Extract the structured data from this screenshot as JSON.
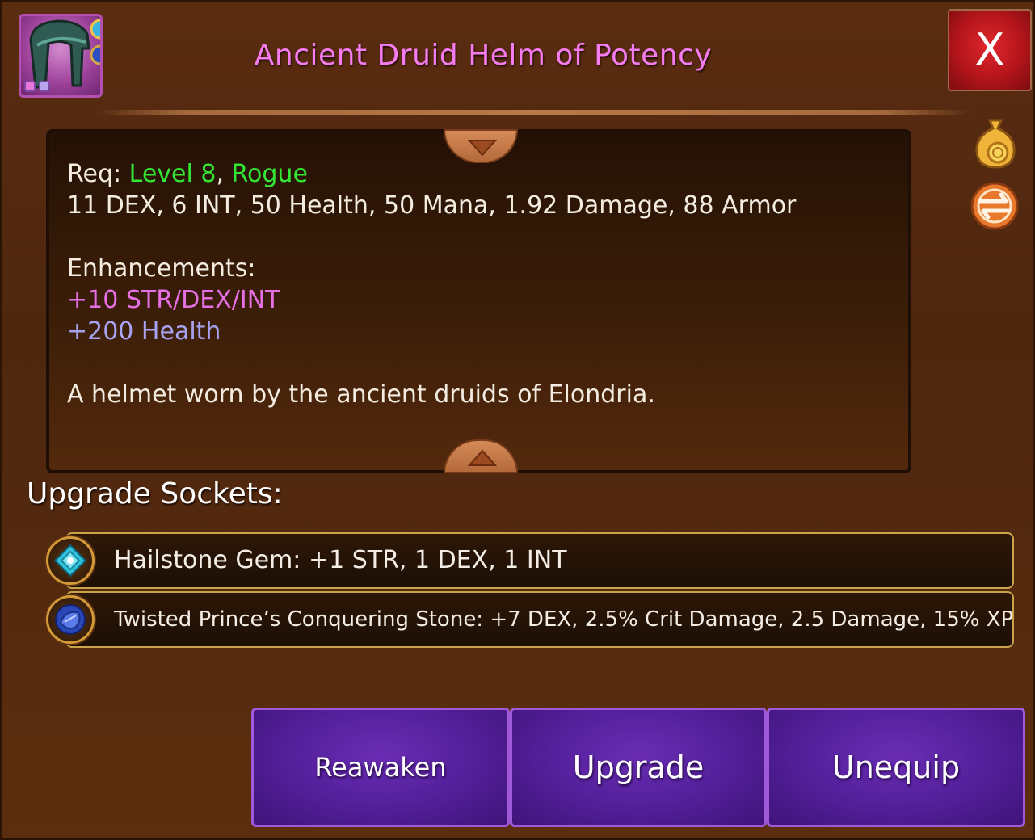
{
  "item": {
    "name": "Ancient Druid Helm of Potency",
    "icon": "druid-helm-icon"
  },
  "close_label": "X",
  "requirements": {
    "prefix": "Req: ",
    "level": "Level 8",
    "separator": ", ",
    "class": "Rogue"
  },
  "stats_line": "11 DEX, 6 INT, 50 Health, 50 Mana, 1.92 Damage, 88 Armor",
  "enhancements": {
    "heading": "Enhancements:",
    "lines": [
      "+10 STR/DEX/INT",
      "+200 Health"
    ]
  },
  "description": "A helmet worn by the ancient druids of Elondria.",
  "sockets": {
    "heading": "Upgrade Sockets:",
    "items": [
      {
        "icon": "hailstone-gem-icon",
        "text": "Hailstone Gem: +1 STR, 1 DEX, 1 INT"
      },
      {
        "icon": "conquering-stone-icon",
        "text": "Twisted Prince’s Conquering Stone: +7 DEX, 2.5% Crit Damage, 2.5 Damage, 15% XP"
      }
    ]
  },
  "side_icons": [
    "gold-bag-icon",
    "trade-swap-icon"
  ],
  "buttons": {
    "reawaken": "Reawaken",
    "upgrade": "Upgrade",
    "unequip": "Unequip"
  },
  "colors": {
    "title": "#f47cf0",
    "level_class": "#33e633",
    "enhancement_stat": "#e66fe6",
    "enhancement_health": "#a7a3f2",
    "button_purple": "#5a22a6",
    "close_red": "#c0161c"
  }
}
